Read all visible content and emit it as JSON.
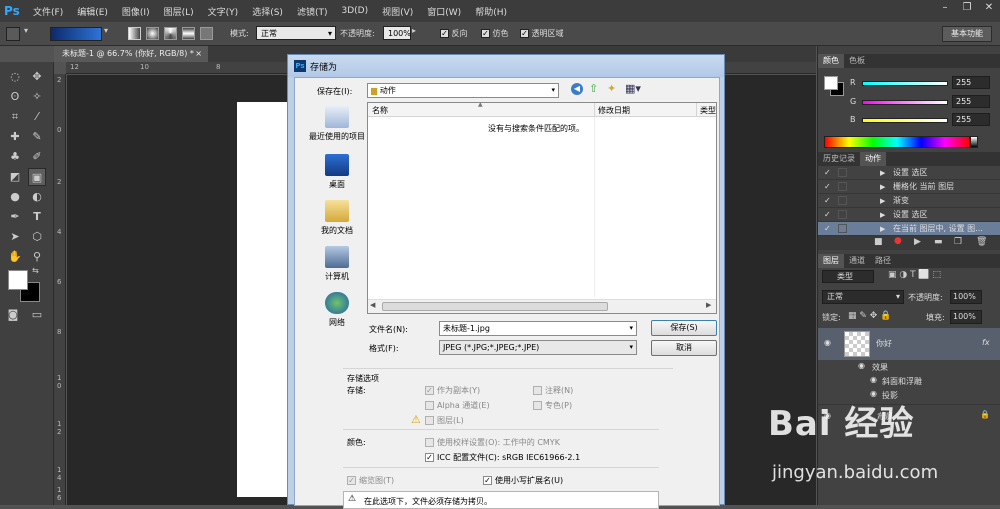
{
  "app": {
    "logo": "Ps",
    "menu": [
      "文件(F)",
      "编辑(E)",
      "图像(I)",
      "图层(L)",
      "文字(Y)",
      "选择(S)",
      "滤镜(T)",
      "3D(D)",
      "视图(V)",
      "窗口(W)",
      "帮助(H)"
    ]
  },
  "options": {
    "mode_label": "模式:",
    "mode_value": "正常",
    "opacity_label": "不透明度:",
    "opacity_value": "100%",
    "reverse": "反向",
    "dither": "仿色",
    "transparency": "透明区域",
    "workspace": "基本功能"
  },
  "doc": {
    "tab_title": "未标题-1 @ 66.7% (你好, RGB/8) *",
    "ruler_top": [
      "12",
      "10",
      "8"
    ],
    "ruler_left": [
      "2",
      "0",
      "2",
      "4",
      "6",
      "8",
      "1",
      "0",
      "1",
      "2",
      "1",
      "4",
      "1",
      "6"
    ]
  },
  "color_panel": {
    "tabs": [
      "颜色",
      "色板"
    ],
    "r_label": "R",
    "g_label": "G",
    "b_label": "B",
    "r_value": "255",
    "g_value": "255",
    "b_value": "255"
  },
  "actions_panel": {
    "tabs": [
      "历史记录",
      "动作"
    ],
    "rows": [
      "设置 选区",
      "栅格化 当前 图层",
      "渐变",
      "设置 选区",
      "在当前 图层中, 设置 图..."
    ],
    "check": "✓"
  },
  "layers_panel": {
    "tabs": [
      "图层",
      "通道",
      "路径"
    ],
    "filter": "类型",
    "blend": "正常",
    "opacity_label": "不透明度:",
    "opacity_value": "100%",
    "lock_label": "锁定:",
    "fill_label": "填充:",
    "fill_value": "100%",
    "layer_name": "你好",
    "fx": "fx",
    "effects": "效果",
    "effect1": "斜面和浮雕",
    "effect2": "投影",
    "bg_layer": "背景"
  },
  "dialog": {
    "title": "存储为",
    "save_in_label": "保存在(I):",
    "save_in_value": "动作",
    "places": [
      "最近使用的项目",
      "桌面",
      "我的文档",
      "计算机",
      "网络"
    ],
    "col_name": "名称",
    "col_date": "修改日期",
    "col_type": "类型",
    "empty_msg": "没有与搜索条件匹配的项。",
    "filename_label": "文件名(N):",
    "filename_value": "未标题-1.jpg",
    "format_label": "格式(F):",
    "format_value": "JPEG (*.JPG;*.JPEG;*.JPE)",
    "save_btn": "保存(S)",
    "cancel_btn": "取消",
    "save_options_title": "存储选项",
    "save_label": "存储:",
    "as_copy": "作为副本(Y)",
    "notes": "注释(N)",
    "alpha": "Alpha 通道(E)",
    "spot": "专色(P)",
    "layers": "图层(L)",
    "color_label": "颜色:",
    "use_proof": "使用校样设置(O): 工作中的 CMYK",
    "icc": "ICC 配置文件(C): sRGB IEC61966-2.1",
    "thumbnail": "缩览图(T)",
    "lowercase_ext": "使用小写扩展名(U)",
    "warning_text": "在此选项下，文件必须存储为拷贝。"
  },
  "watermark": {
    "text": "Bai 经验",
    "url": "jingyan.baidu.com"
  }
}
